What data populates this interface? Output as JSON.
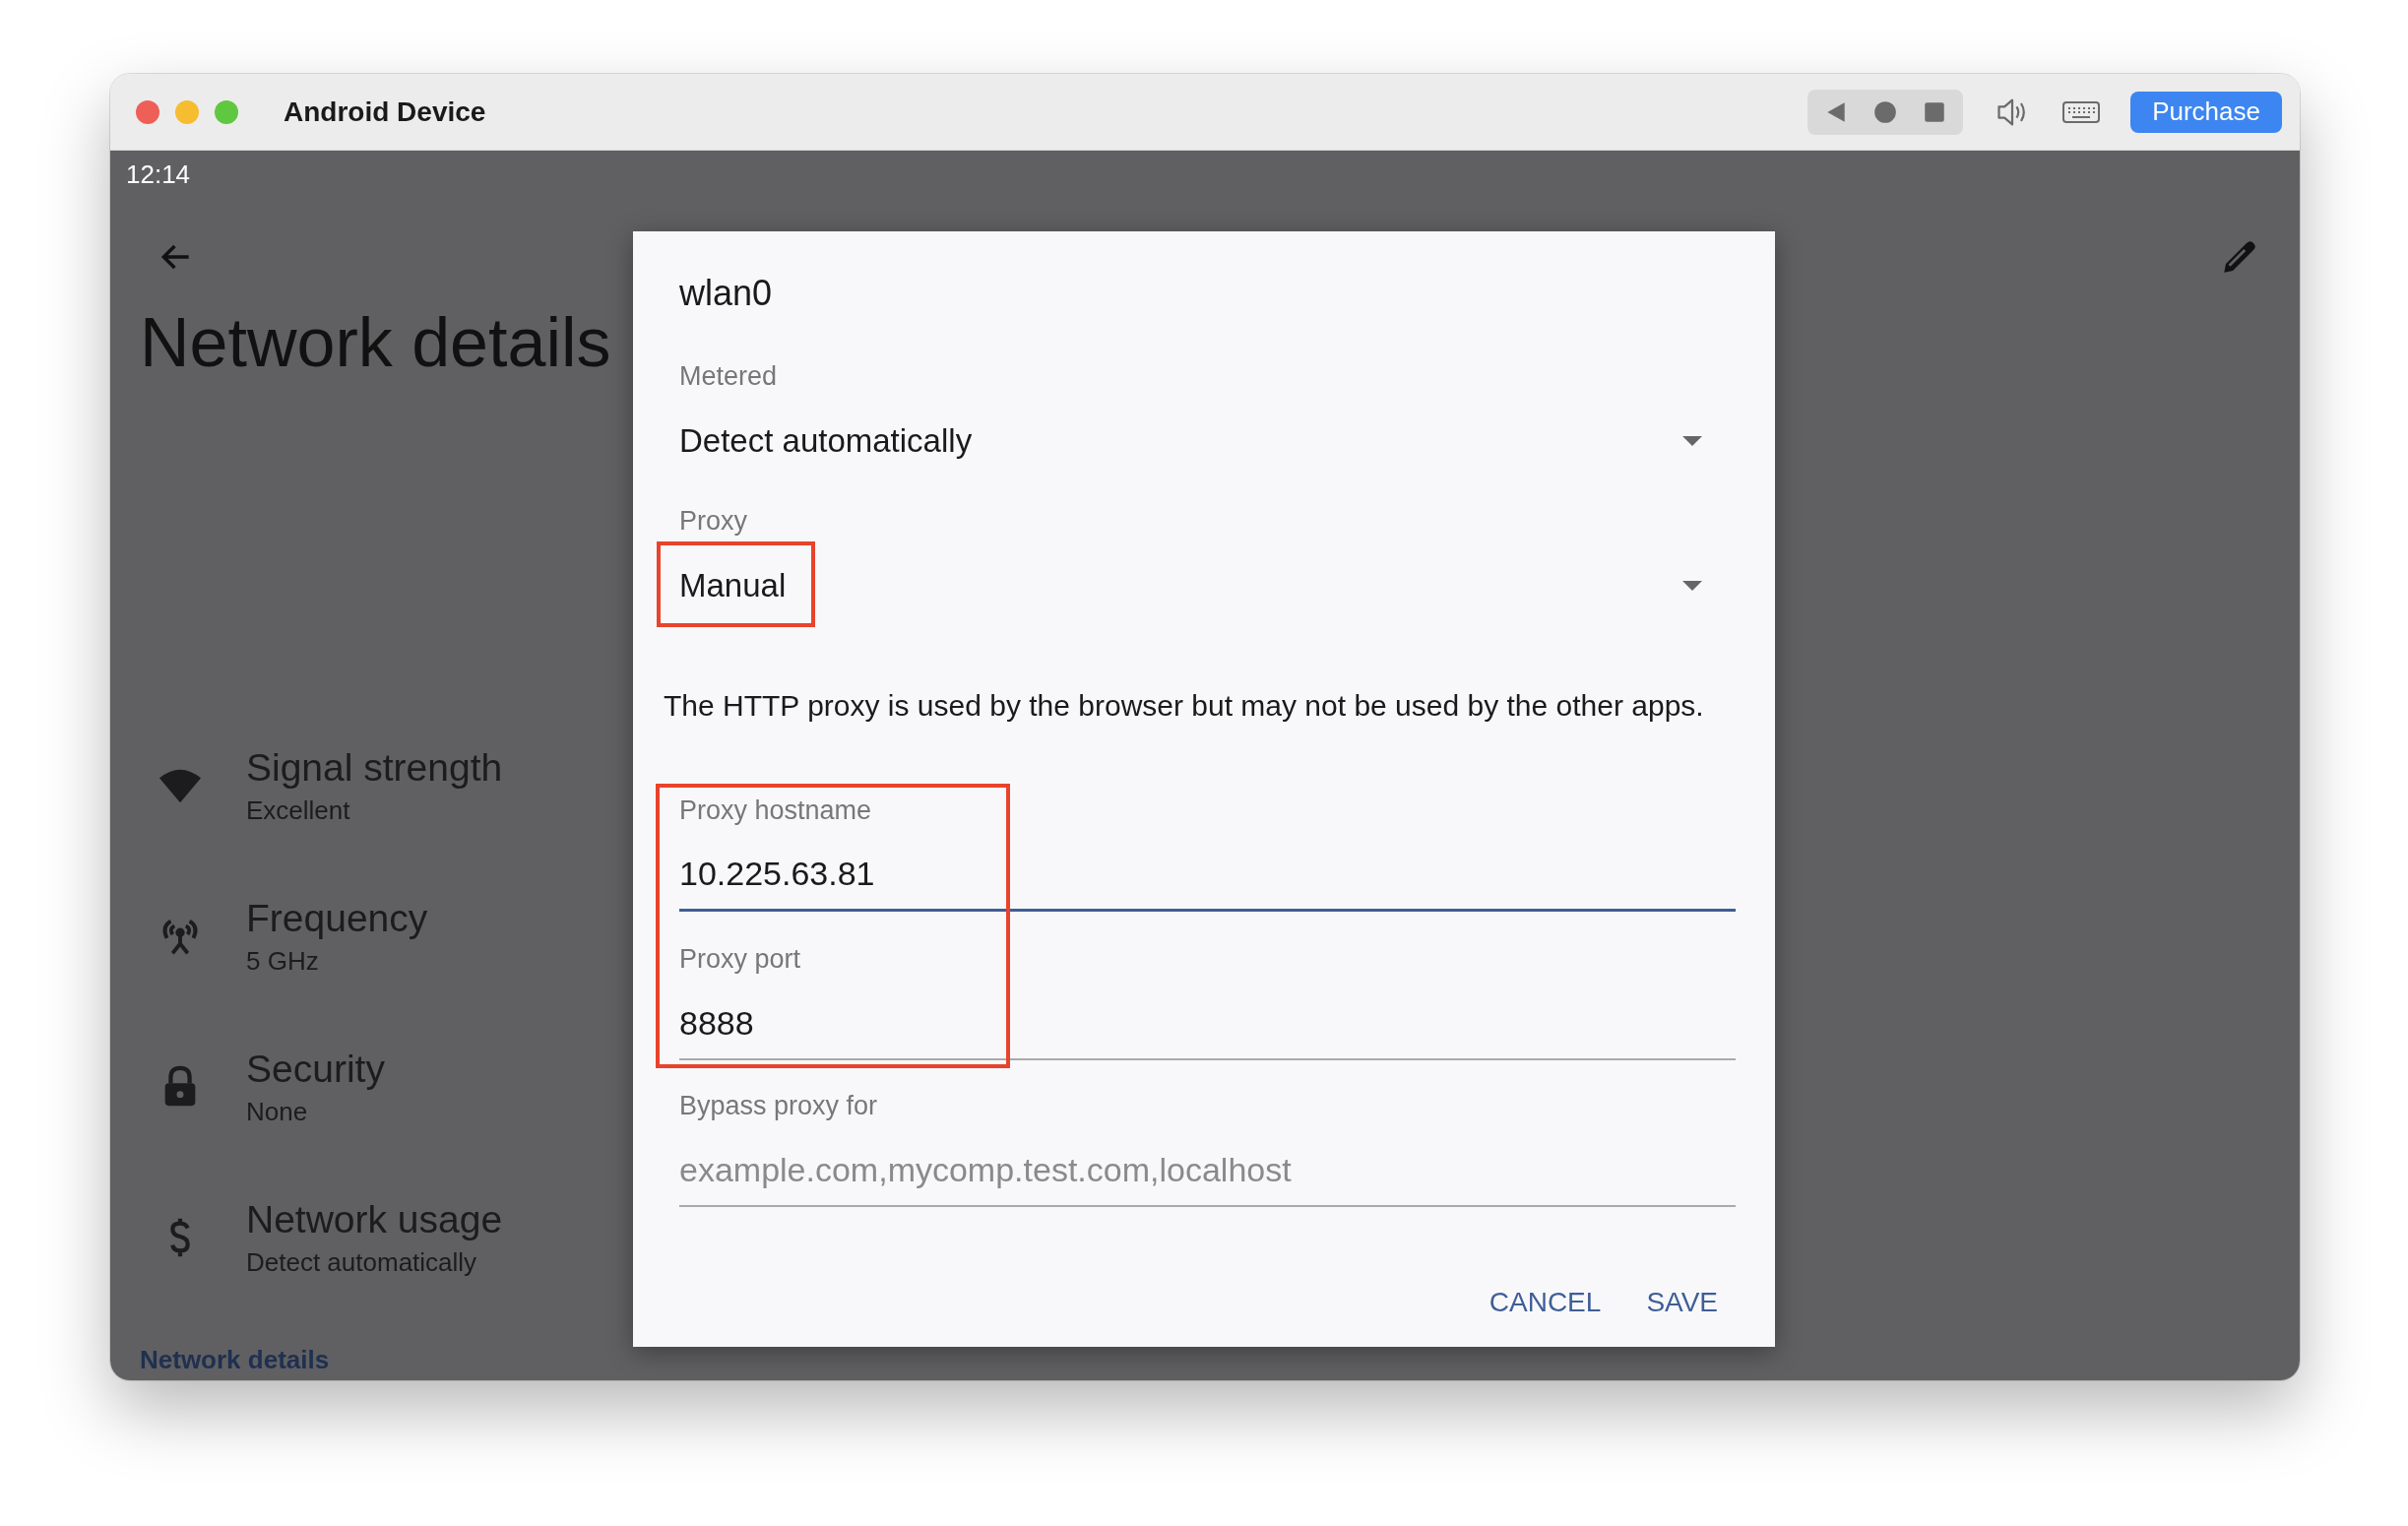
{
  "window": {
    "title": "Android Device",
    "purchase_button": "Purchase"
  },
  "status_bar": {
    "time": "12:14"
  },
  "page": {
    "title": "Network details",
    "items": [
      {
        "kind": "signal",
        "title": "Signal strength",
        "value": "Excellent"
      },
      {
        "kind": "frequency",
        "title": "Frequency",
        "value": "5 GHz"
      },
      {
        "kind": "security",
        "title": "Security",
        "value": "None"
      },
      {
        "kind": "usage",
        "title": "Network usage",
        "value": "Detect automatically"
      }
    ],
    "section_header": "Network details"
  },
  "dialog": {
    "title": "wlan0",
    "dropdowns": [
      {
        "label": "Metered",
        "value": "Detect automatically",
        "highlighted": false
      },
      {
        "label": "Proxy",
        "value": "Manual",
        "highlighted": true
      }
    ],
    "note": "The HTTP proxy is used by the browser but may not be used by the other apps.",
    "fields": [
      {
        "label": "Proxy hostname",
        "value": "10.225.63.81",
        "focused": true,
        "highlighted": true
      },
      {
        "label": "Proxy port",
        "value": "8888",
        "focused": false,
        "highlighted": true
      },
      {
        "label": "Bypass proxy for",
        "placeholder": "example.com,mycomp.test.com,localhost",
        "focused": false,
        "highlighted": false
      }
    ],
    "buttons": [
      "CANCEL",
      "SAVE"
    ]
  }
}
